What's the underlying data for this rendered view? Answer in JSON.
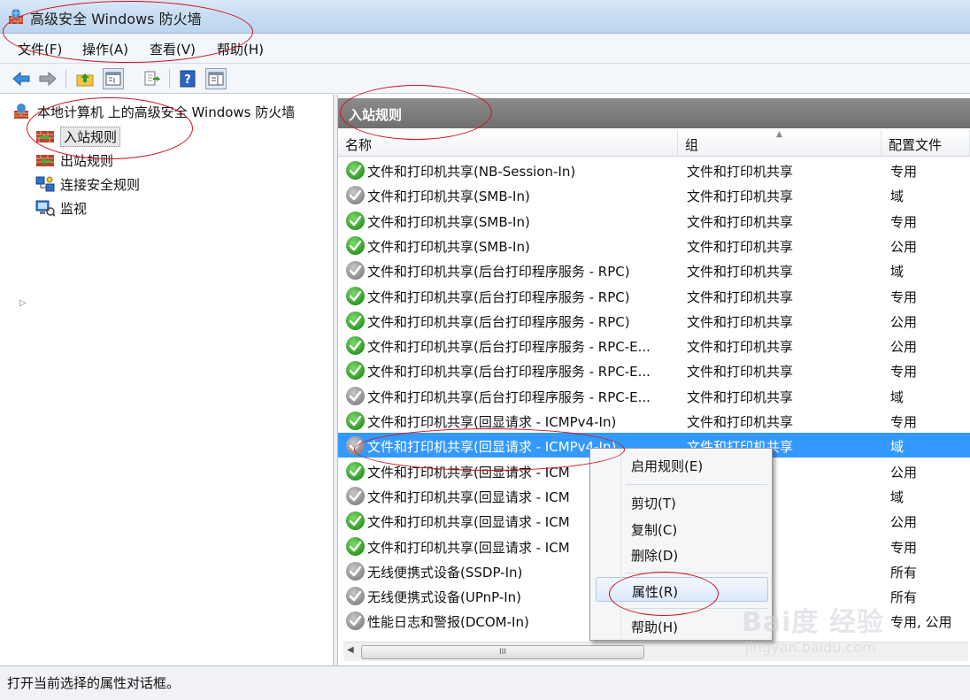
{
  "window": {
    "title": "高级安全 Windows 防火墙"
  },
  "menubar": [
    "文件(F)",
    "操作(A)",
    "查看(V)",
    "帮助(H)"
  ],
  "toolbar": [
    "back-icon",
    "forward-icon",
    "up-folder-icon",
    "show-hide-tree-icon",
    "export-icon",
    "help-icon",
    "action-pane-icon"
  ],
  "tree": {
    "root": "本地计算机 上的高级安全 Windows 防火墙",
    "items": [
      "入站规则",
      "出站规则",
      "连接安全规则",
      "监视"
    ]
  },
  "pane": {
    "header": "入站规则",
    "columns": [
      "名称",
      "组",
      "配置文件"
    ]
  },
  "rules": [
    {
      "name": "文件和打印机共享(NB-Session-In)",
      "group": "文件和打印机共享",
      "profile": "专用",
      "enabled": true
    },
    {
      "name": "文件和打印机共享(SMB-In)",
      "group": "文件和打印机共享",
      "profile": "域",
      "enabled": false
    },
    {
      "name": "文件和打印机共享(SMB-In)",
      "group": "文件和打印机共享",
      "profile": "专用",
      "enabled": true
    },
    {
      "name": "文件和打印机共享(SMB-In)",
      "group": "文件和打印机共享",
      "profile": "公用",
      "enabled": true
    },
    {
      "name": "文件和打印机共享(后台打印程序服务 - RPC)",
      "group": "文件和打印机共享",
      "profile": "域",
      "enabled": false
    },
    {
      "name": "文件和打印机共享(后台打印程序服务 - RPC)",
      "group": "文件和打印机共享",
      "profile": "专用",
      "enabled": true
    },
    {
      "name": "文件和打印机共享(后台打印程序服务 - RPC)",
      "group": "文件和打印机共享",
      "profile": "公用",
      "enabled": true
    },
    {
      "name": "文件和打印机共享(后台打印程序服务 - RPC-E...",
      "group": "文件和打印机共享",
      "profile": "公用",
      "enabled": true
    },
    {
      "name": "文件和打印机共享(后台打印程序服务 - RPC-E...",
      "group": "文件和打印机共享",
      "profile": "专用",
      "enabled": true
    },
    {
      "name": "文件和打印机共享(后台打印程序服务 - RPC-E...",
      "group": "文件和打印机共享",
      "profile": "域",
      "enabled": false
    },
    {
      "name": "文件和打印机共享(回显请求 - ICMPv4-In)",
      "group": "文件和打印机共享",
      "profile": "专用",
      "enabled": true
    },
    {
      "name": "文件和打印机共享(回显请求 - ICMPv4-In)",
      "group": "文件和打印机共享",
      "profile": "域",
      "enabled": false,
      "selected": true
    },
    {
      "name": "文件和打印机共享(回显请求 - ICM",
      "group": "共享",
      "profile": "公用",
      "enabled": true
    },
    {
      "name": "文件和打印机共享(回显请求 - ICM",
      "group": "共享",
      "profile": "域",
      "enabled": false
    },
    {
      "name": "文件和打印机共享(回显请求 - ICM",
      "group": "共享",
      "profile": "公用",
      "enabled": true
    },
    {
      "name": "文件和打印机共享(回显请求 - ICM",
      "group": "共享",
      "profile": "专用",
      "enabled": true
    },
    {
      "name": "无线便携式设备(SSDP-In)",
      "group": "",
      "profile": "所有",
      "enabled": false
    },
    {
      "name": "无线便携式设备(UPnP-In)",
      "group": "",
      "profile": "所有",
      "enabled": false
    },
    {
      "name": "性能日志和警报(DCOM-In)",
      "group": "报",
      "profile": "专用, 公用",
      "enabled": false
    }
  ],
  "context_menu": [
    "启用规则(E)",
    "剪切(T)",
    "复制(C)",
    "删除(D)",
    "属性(R)",
    "帮助(H)"
  ],
  "scrollbar": {
    "grip": "III"
  },
  "statusbar": {
    "text": "打开当前选择的属性对话框。"
  },
  "colors": {
    "selection": "#3399ff",
    "annotation": "#d0121b",
    "header_gray": "#7a7a7a"
  },
  "watermark": {
    "logo": "Bai度 经验",
    "url": "jingyan.baidu.com"
  }
}
